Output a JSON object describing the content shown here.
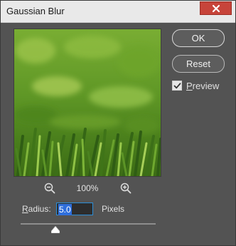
{
  "window": {
    "title": "Gaussian Blur"
  },
  "zoom": {
    "level": "100%"
  },
  "radius": {
    "label_prefix": "R",
    "label_rest": "adius:",
    "value": "5.0",
    "units": "Pixels",
    "slider_fraction": 0.26
  },
  "buttons": {
    "ok": "OK",
    "reset": "Reset"
  },
  "preview": {
    "checked": true,
    "label_prefix": "P",
    "label_rest": "review"
  },
  "icons": {
    "close": "close-icon",
    "zoom_out": "zoom-out-icon",
    "zoom_in": "zoom-in-icon",
    "check": "check-icon"
  },
  "colors": {
    "dialog_bg": "#535353",
    "titlebar": "#e9e9e9",
    "close": "#c7443a",
    "selection": "#2f6fdc",
    "grass_light": "#8bbf3c",
    "grass_dark": "#2f5d14"
  }
}
